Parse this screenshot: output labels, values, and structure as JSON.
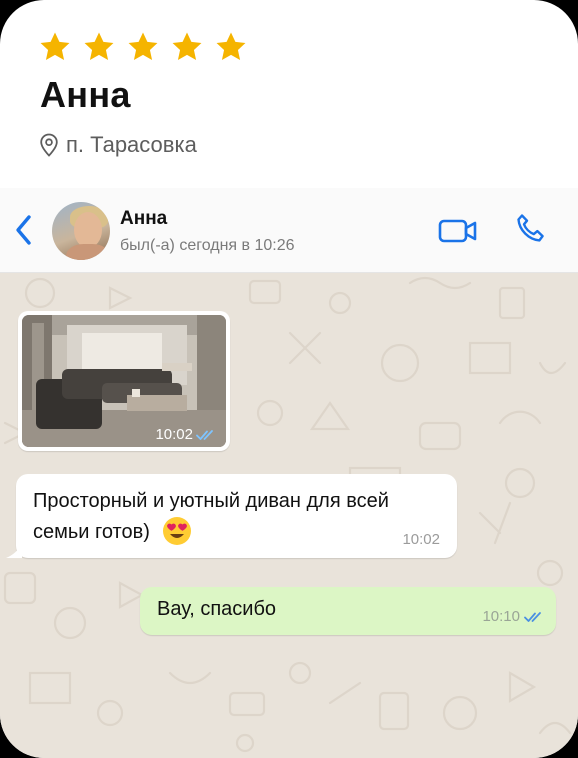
{
  "review": {
    "rating": 5,
    "reviewer_name": "Анна",
    "location": "п. Тарасовка",
    "star_color": "#f5b400"
  },
  "chat_header": {
    "contact_name": "Анна",
    "status": "был(-а) сегодня в 10:26",
    "accent_color": "#1a73e8",
    "icons": [
      "back-arrow-icon",
      "video-call-icon",
      "phone-icon"
    ]
  },
  "messages": [
    {
      "direction": "incoming",
      "type": "photo",
      "time": "10:02",
      "read": true
    },
    {
      "direction": "incoming",
      "type": "text",
      "text": "Просторный и уютный диван для всей семьи готов)",
      "emoji": "heart-eyes-emoji",
      "time": "10:02"
    },
    {
      "direction": "outgoing",
      "type": "text",
      "text": "Вау, спасибо",
      "time": "10:10",
      "read": true
    }
  ]
}
